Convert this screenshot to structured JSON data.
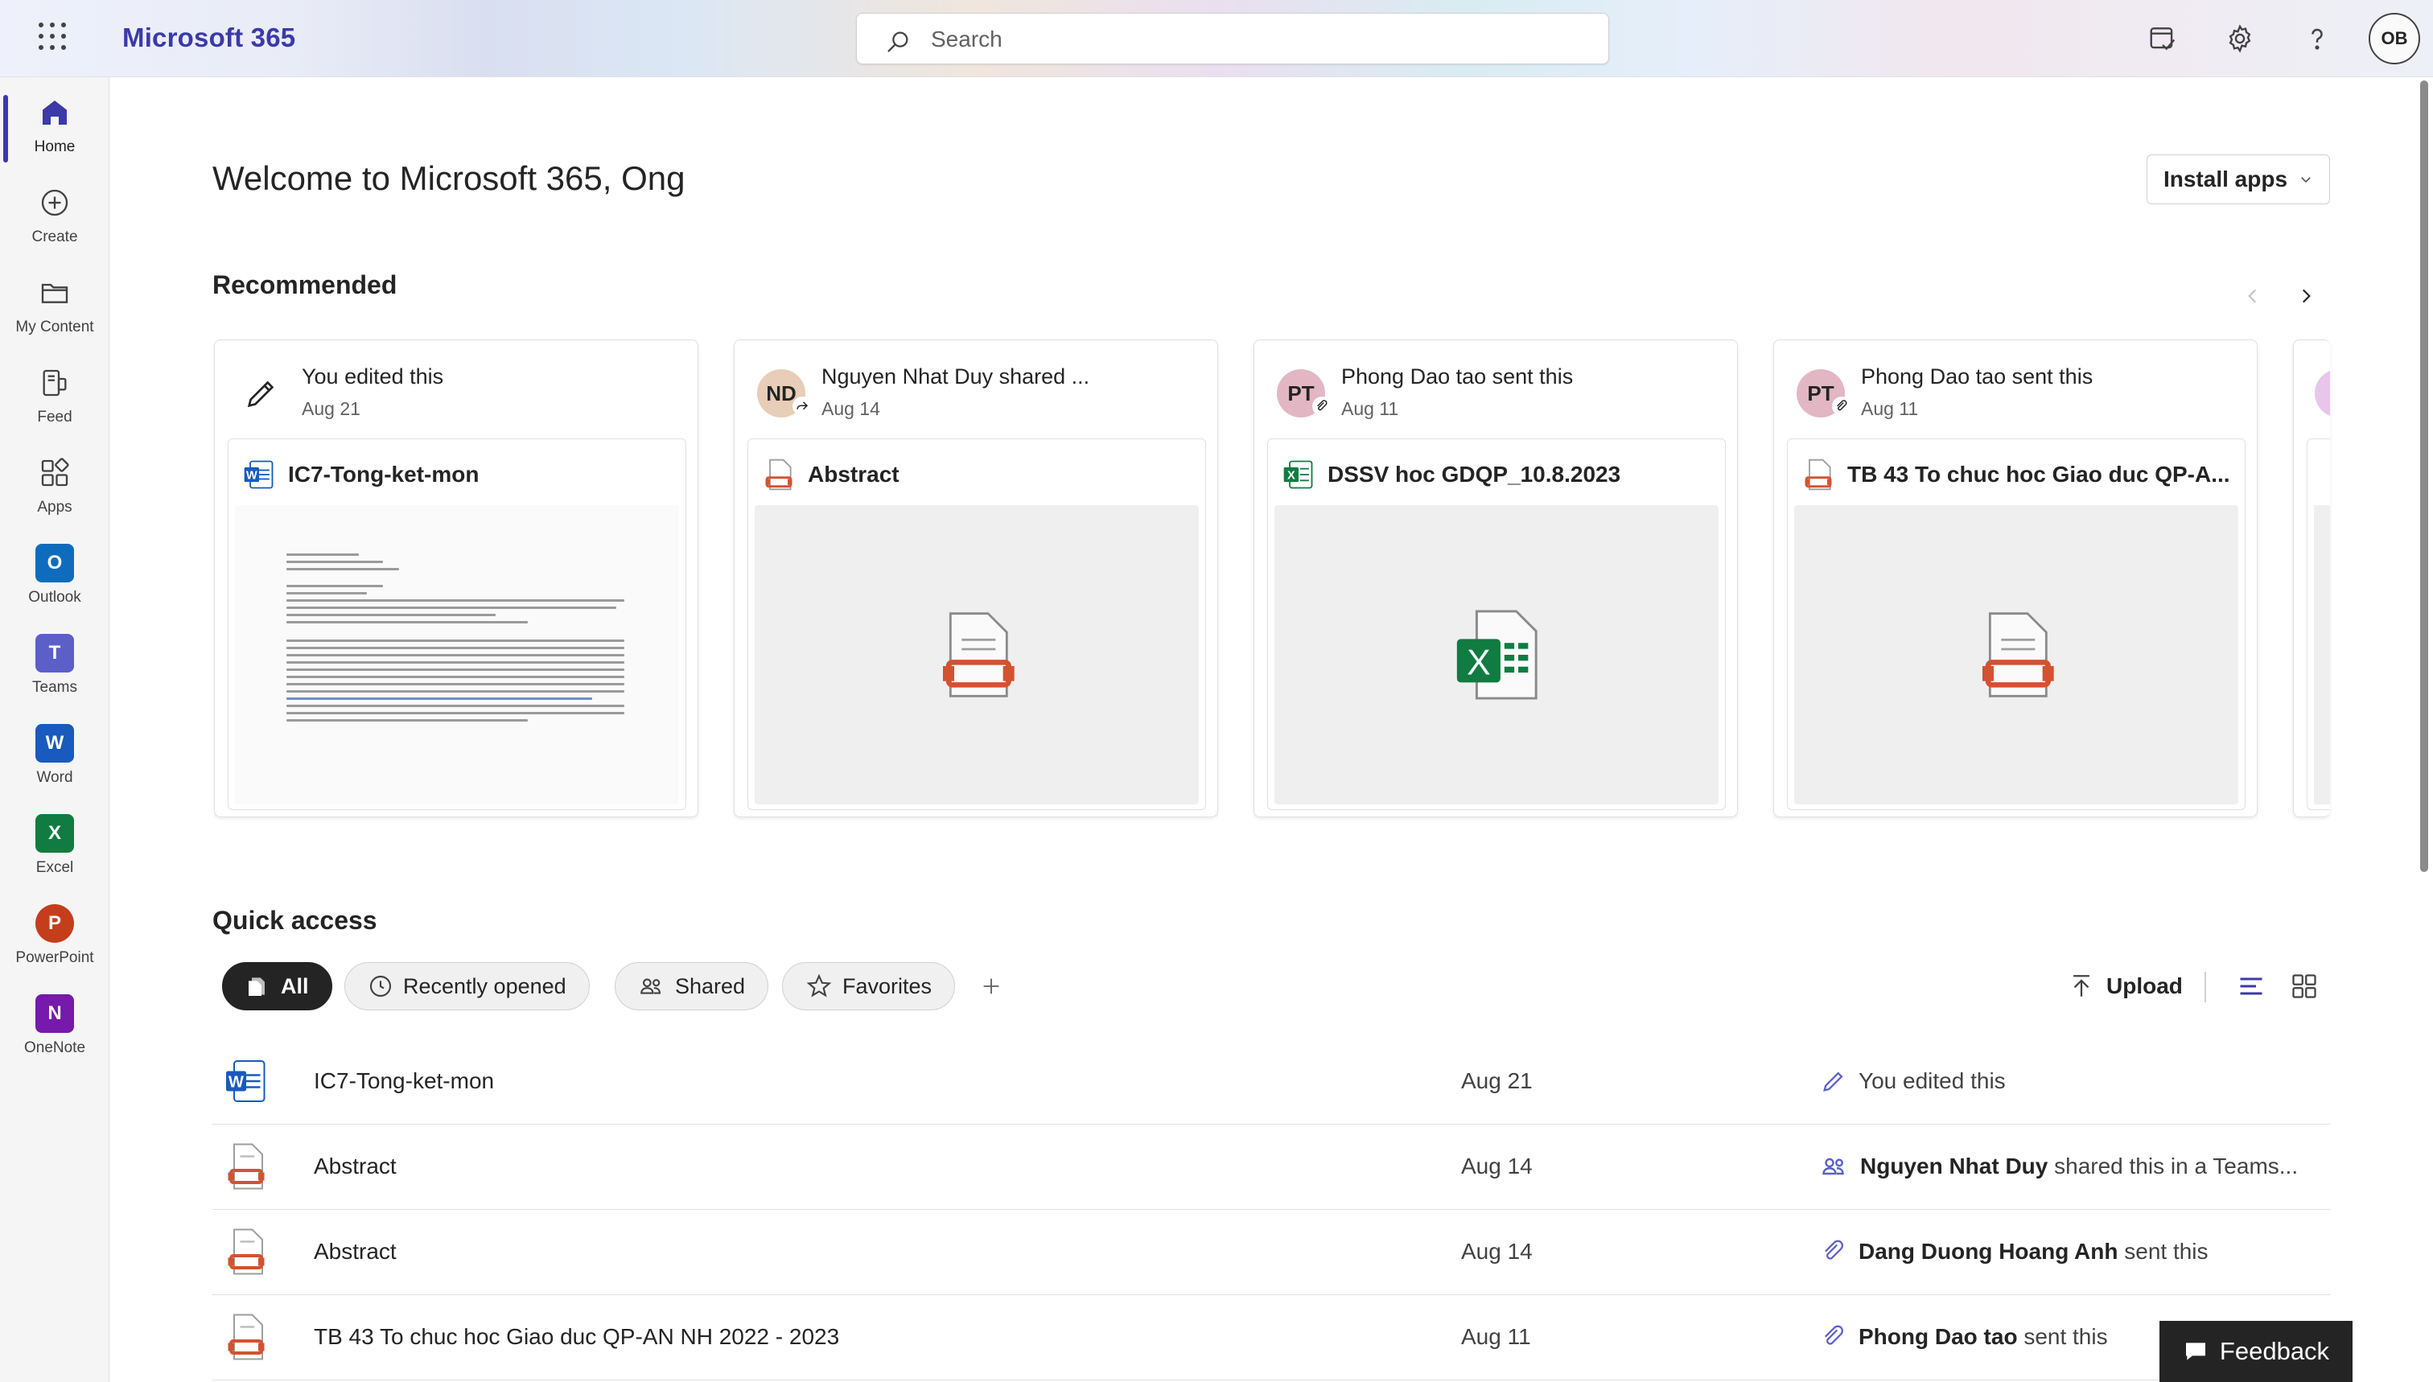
{
  "app": {
    "name": "Microsoft 365",
    "search_placeholder": "Search",
    "user_initials": "OB"
  },
  "rail": {
    "items": [
      {
        "label": "Home",
        "icon": "home-icon"
      },
      {
        "label": "Create",
        "icon": "plus-circle-icon"
      },
      {
        "label": "My Content",
        "icon": "folder-icon"
      },
      {
        "label": "Feed",
        "icon": "feed-icon"
      },
      {
        "label": "Apps",
        "icon": "apps-icon"
      },
      {
        "label": "Outlook",
        "icon": "outlook-icon",
        "letter": "O",
        "color": "#0f6cbd"
      },
      {
        "label": "Teams",
        "icon": "teams-icon",
        "letter": "T",
        "color": "#5b5fc7"
      },
      {
        "label": "Word",
        "icon": "word-icon",
        "letter": "W",
        "color": "#185abd"
      },
      {
        "label": "Excel",
        "icon": "excel-icon",
        "letter": "X",
        "color": "#107c41"
      },
      {
        "label": "PowerPoint",
        "icon": "powerpoint-icon",
        "letter": "P",
        "color": "#c43e1c"
      },
      {
        "label": "OneNote",
        "icon": "onenote-icon",
        "letter": "N",
        "color": "#7719aa"
      }
    ]
  },
  "main": {
    "welcome": "Welcome to Microsoft 365, Ong",
    "install_label": "Install apps",
    "recommended_title": "Recommended",
    "quick_access_title": "Quick access"
  },
  "recommended": [
    {
      "who": "You edited this",
      "date": "Aug 21",
      "file": "IC7-Tong-ket-mon",
      "type": "word",
      "avatar": ""
    },
    {
      "who": "Nguyen Nhat Duy shared ...",
      "date": "Aug 14",
      "file": "Abstract",
      "type": "pdf",
      "avatar": "ND",
      "avatar_color": "#e8cdb8"
    },
    {
      "who": "Phong Dao tao sent this",
      "date": "Aug 11",
      "file": "DSSV hoc GDQP_10.8.2023",
      "type": "excel",
      "avatar": "PT",
      "avatar_color": "#e3b6c3"
    },
    {
      "who": "Phong Dao tao sent this",
      "date": "Aug 11",
      "file": "TB 43 To chuc hoc Giao duc QP-A...",
      "type": "pdf",
      "avatar": "PT",
      "avatar_color": "#e3b6c3"
    }
  ],
  "filters": {
    "all": "All",
    "recent": "Recently opened",
    "shared": "Shared",
    "favorites": "Favorites",
    "upload": "Upload"
  },
  "files": [
    {
      "name": "IC7-Tong-ket-mon",
      "date": "Aug 21",
      "type": "word",
      "activity_icon": "pencil-icon",
      "actor": "",
      "activity": "You edited this"
    },
    {
      "name": "Abstract",
      "date": "Aug 14",
      "type": "pdf",
      "activity_icon": "people-icon",
      "actor": "Nguyen Nhat Duy",
      "activity": " shared this in a Teams..."
    },
    {
      "name": "Abstract",
      "date": "Aug 14",
      "type": "pdf",
      "activity_icon": "attachment-icon",
      "actor": "Dang Duong Hoang Anh",
      "activity": " sent this"
    },
    {
      "name": "TB 43 To chuc hoc Giao duc QP-AN NH 2022 - 2023",
      "date": "Aug 11",
      "type": "pdf",
      "activity_icon": "attachment-icon",
      "actor": "Phong Dao tao",
      "activity": " sent this"
    }
  ],
  "feedback_label": "Feedback",
  "colors": {
    "brand": "#3b3aa8",
    "word": "#185abd",
    "excel": "#107c41",
    "pdf": "#d35230"
  }
}
